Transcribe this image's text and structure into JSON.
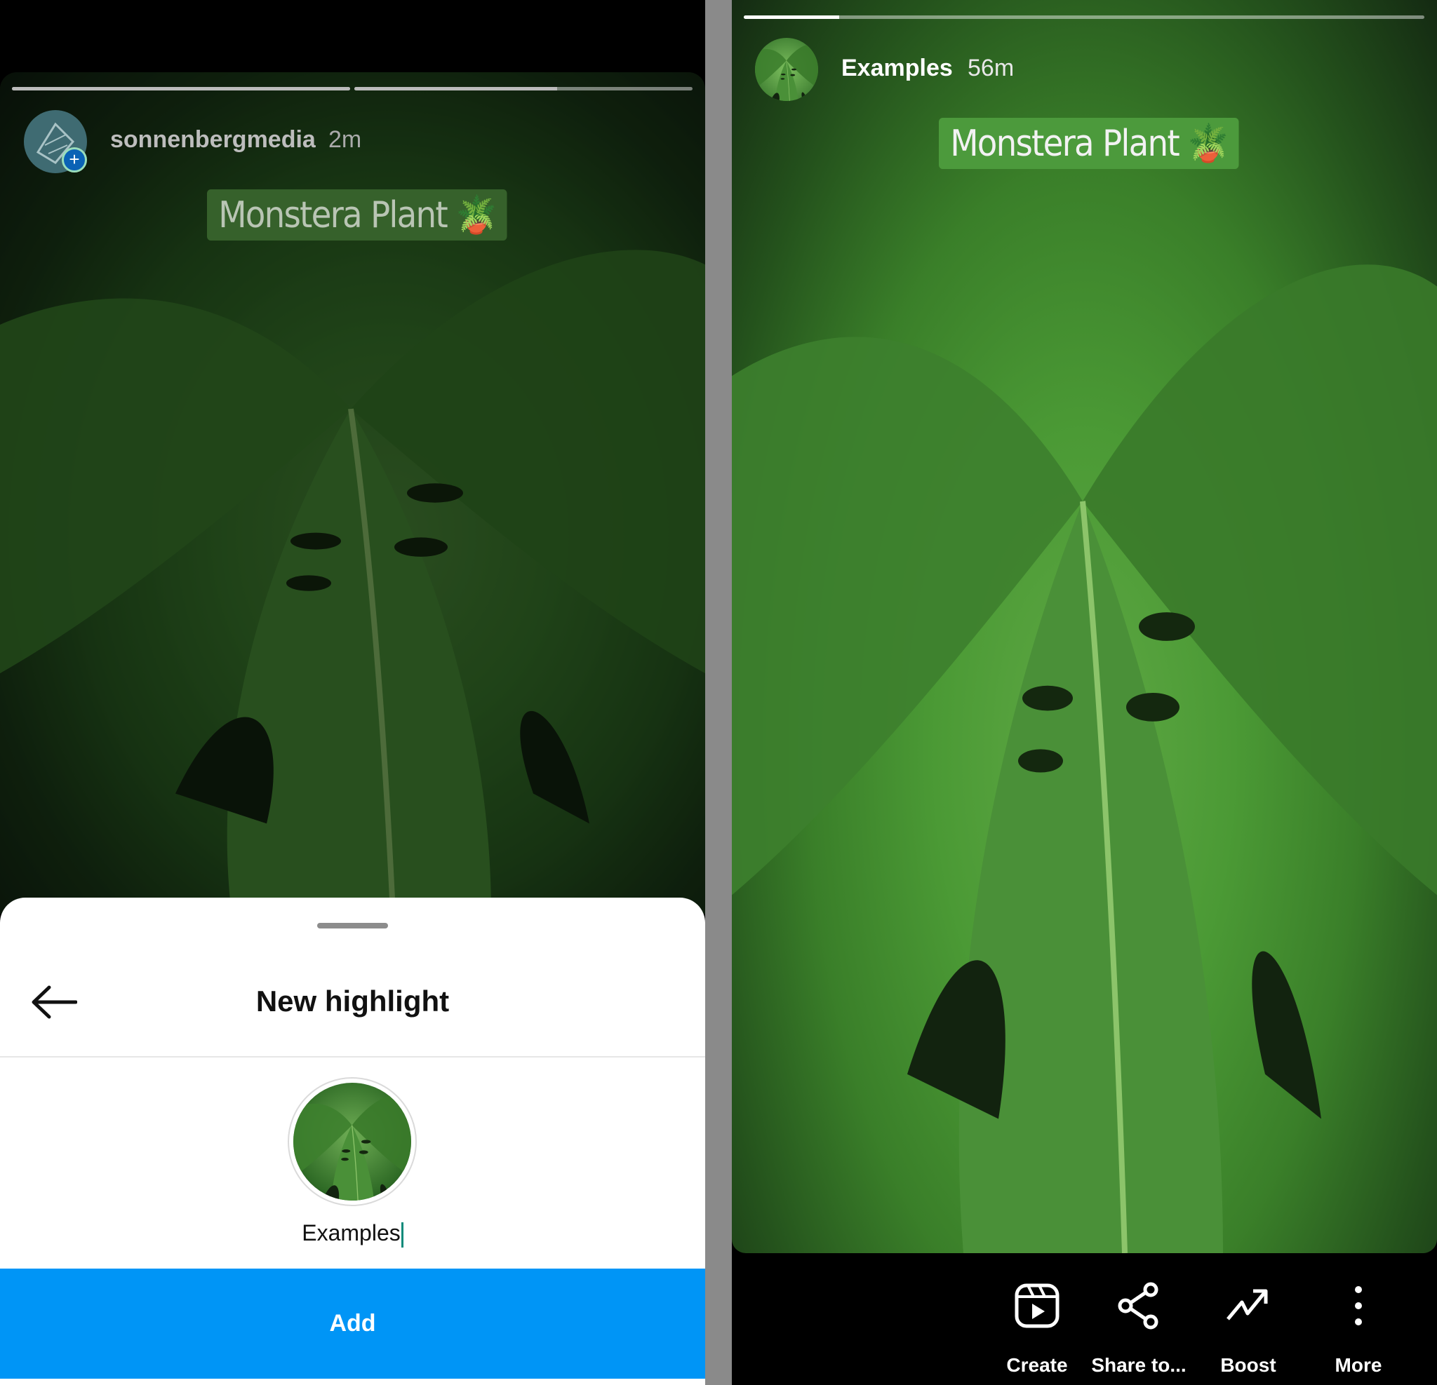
{
  "left_story": {
    "username": "sonnenbergmedia",
    "time": "2m",
    "sticker_text": "Monstera Plant",
    "sticker_emoji": "🪴",
    "progress": [
      1.0,
      0.6
    ]
  },
  "sheet": {
    "title": "New highlight",
    "highlight_name_value": "Examples",
    "add_label": "Add"
  },
  "right_story": {
    "highlight_name": "Examples",
    "time": "56m",
    "sticker_text": "Monstera Plant",
    "sticker_emoji": "🪴",
    "progress": 0.14,
    "actions": [
      {
        "label": "Create",
        "icon": "reels-icon"
      },
      {
        "label": "Share to...",
        "icon": "share-icon"
      },
      {
        "label": "Boost",
        "icon": "trending-up-icon"
      },
      {
        "label": "More",
        "icon": "more-vertical-icon"
      }
    ]
  },
  "colors": {
    "accent": "#0095f6",
    "sticker": "#4c9a3c"
  }
}
